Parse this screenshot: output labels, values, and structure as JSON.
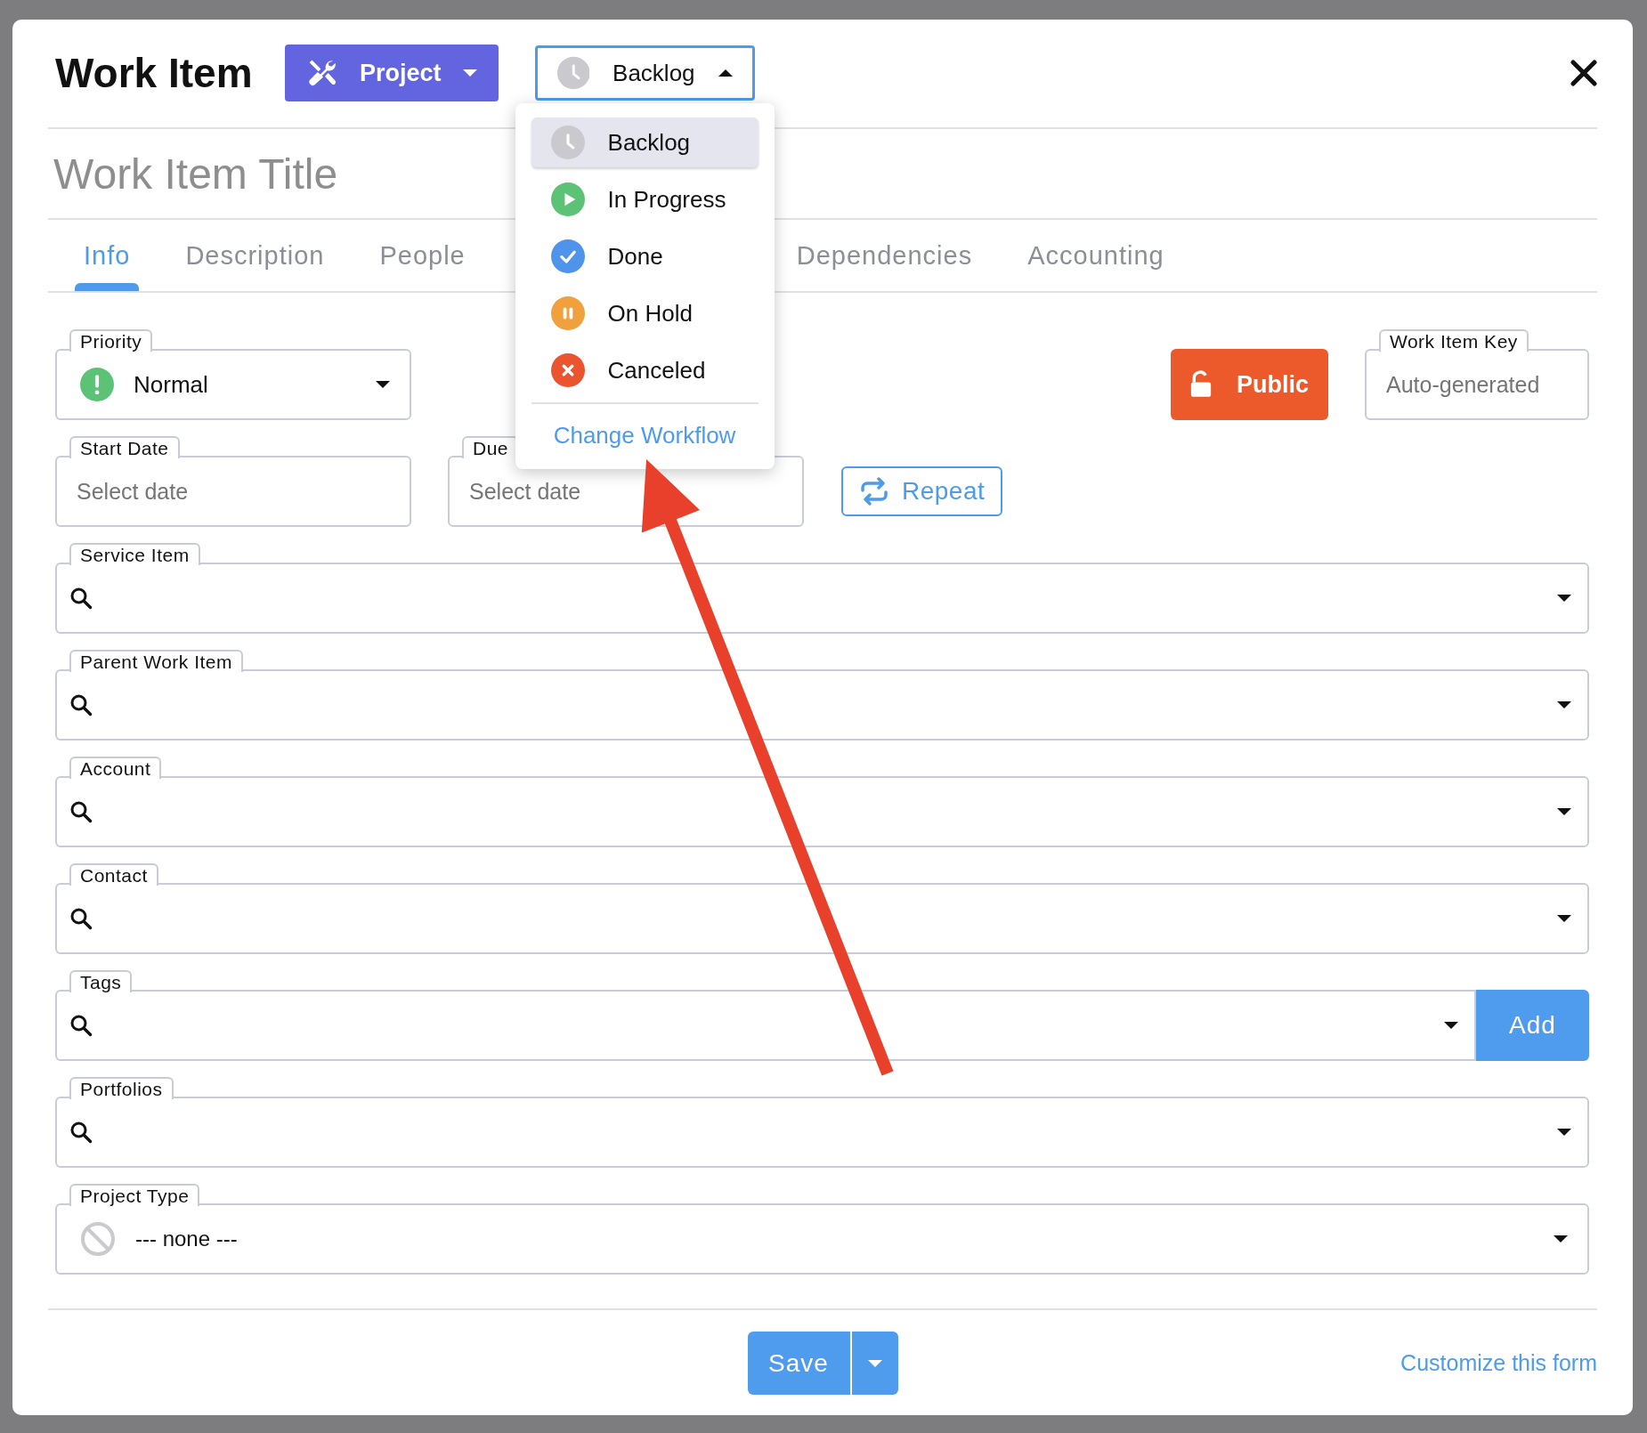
{
  "header": {
    "title": "Work Item",
    "type_button": {
      "label": "Project"
    },
    "status_select": {
      "value": "Backlog",
      "kind": "backlog",
      "expanded": true
    }
  },
  "title_field": {
    "placeholder": "Work Item Title"
  },
  "tabs": [
    {
      "label": "Info",
      "selected": true
    },
    {
      "label": "Description",
      "selected": false
    },
    {
      "label": "People",
      "selected": false
    },
    {
      "label": "Dependencies",
      "selected": false
    },
    {
      "label": "Accounting",
      "selected": false
    }
  ],
  "status_menu": {
    "items": [
      {
        "label": "Backlog",
        "kind": "backlog",
        "selected": true
      },
      {
        "label": "In Progress",
        "kind": "progress",
        "selected": false
      },
      {
        "label": "Done",
        "kind": "done",
        "selected": false
      },
      {
        "label": "On Hold",
        "kind": "hold",
        "selected": false
      },
      {
        "label": "Canceled",
        "kind": "canceled",
        "selected": false
      }
    ],
    "link": "Change Workflow"
  },
  "priority": {
    "label": "Priority",
    "value": "Normal"
  },
  "visibility_button": {
    "label": "Public"
  },
  "key_field": {
    "label": "Work Item Key",
    "placeholder": "Auto-generated"
  },
  "start_date": {
    "label": "Start Date",
    "placeholder": "Select date"
  },
  "due_date": {
    "label": "Due",
    "placeholder": "Select date"
  },
  "repeat_button": {
    "label": "Repeat"
  },
  "lookups": [
    {
      "label": "Service Item"
    },
    {
      "label": "Parent Work Item"
    },
    {
      "label": "Account"
    },
    {
      "label": "Contact"
    },
    {
      "label": "Tags",
      "add_button": "Add"
    },
    {
      "label": "Portfolios"
    }
  ],
  "project_type": {
    "label": "Project Type",
    "value": "--- none ---"
  },
  "footer": {
    "save": "Save",
    "customize_link": "Customize this form"
  }
}
